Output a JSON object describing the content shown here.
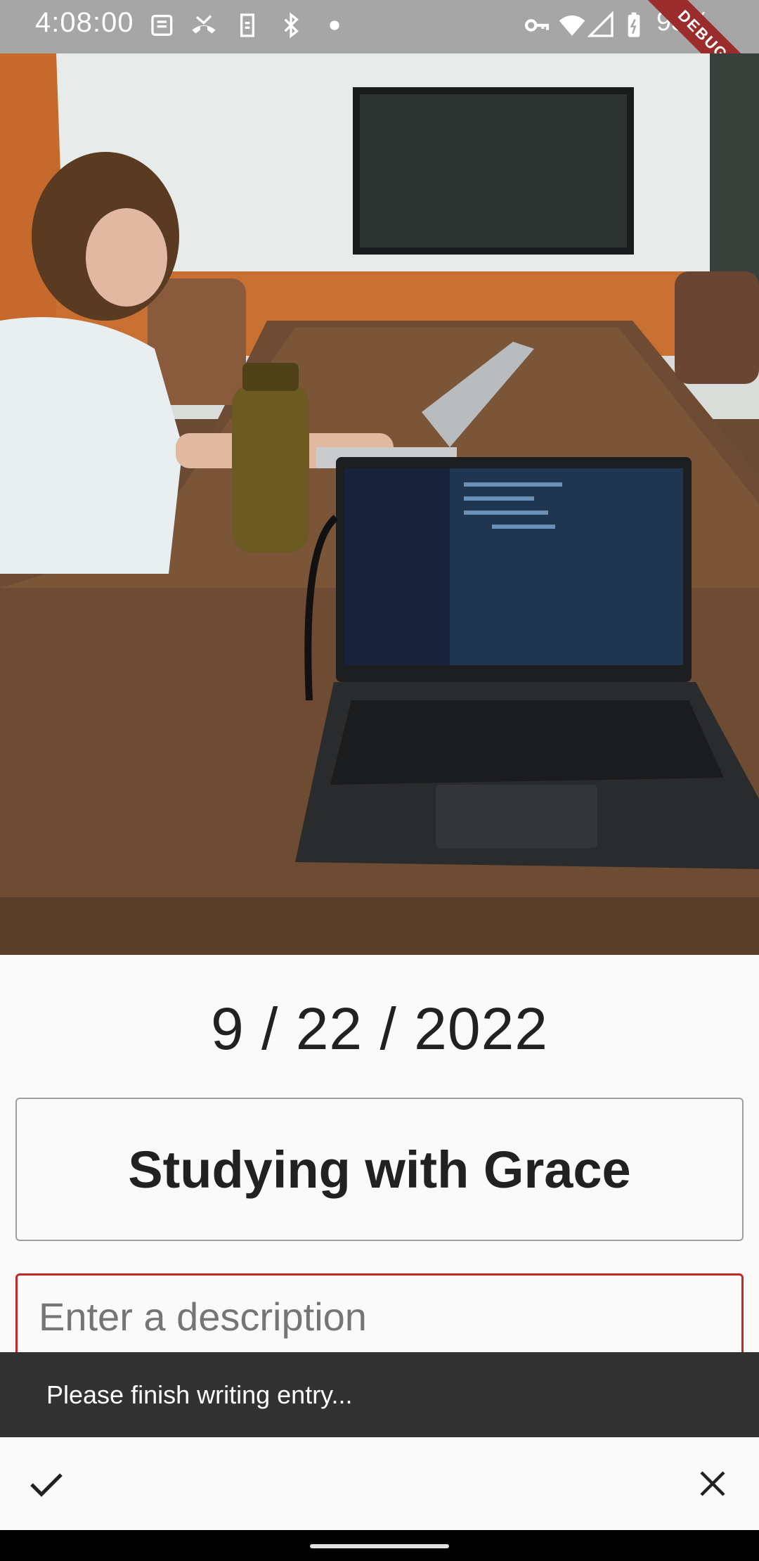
{
  "status_bar": {
    "time": "4:08:00",
    "battery": "93%",
    "debug_label": "DEBUG"
  },
  "entry": {
    "date": "9 / 22 / 2022",
    "title": "Studying with Grace",
    "description_placeholder": "Enter a description"
  },
  "snackbar": {
    "message": "Please finish writing entry..."
  },
  "actions": {
    "confirm_icon": "check-icon",
    "cancel_icon": "close-icon"
  },
  "colors": {
    "error_border": "#c62828",
    "snackbar_bg": "#323232",
    "status_bar_bg": "#a6a6a6"
  }
}
